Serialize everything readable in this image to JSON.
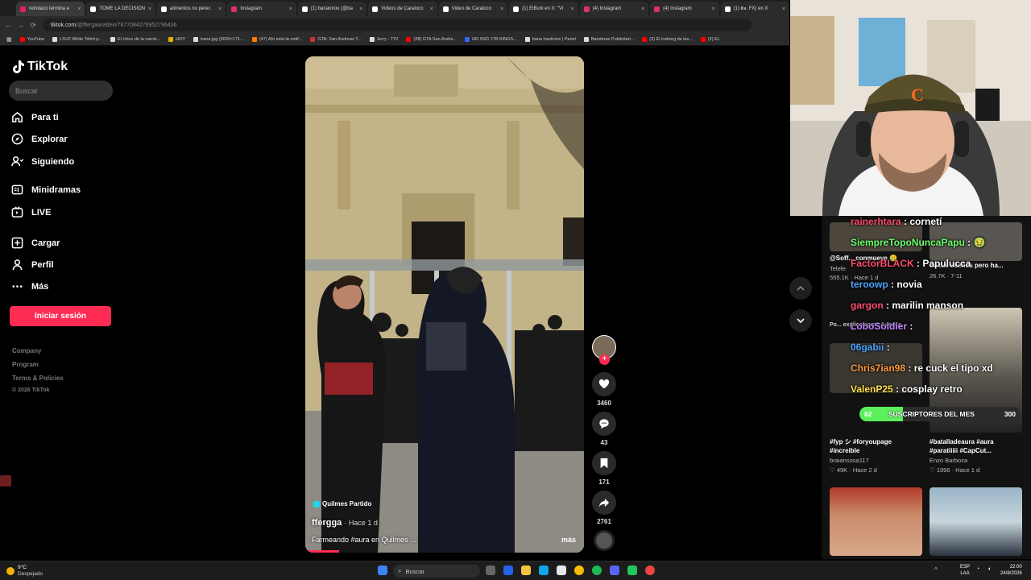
{
  "browser": {
    "tabs": [
      {
        "label": "retrolazo termina e",
        "color": "#e91e63"
      },
      {
        "label": "TOME LA DECISION",
        "color": "#ffffff"
      },
      {
        "label": "alimentos no perec",
        "color": "#ffffff"
      },
      {
        "label": "Instagram",
        "color": "#e1306c"
      },
      {
        "label": "(1) bananirou (@ba",
        "color": "#ffffff"
      },
      {
        "label": "Videos de Caraloco",
        "color": "#ffffff"
      },
      {
        "label": "Video de Caraloco",
        "color": "#ffffff"
      },
      {
        "label": "(1) ElBuni en X: \"Vi",
        "color": "#ffffff"
      },
      {
        "label": "(4) Instagram",
        "color": "#e1306c"
      },
      {
        "label": "(4) Instagram",
        "color": "#e1306c"
      },
      {
        "label": "(1) 𝕰𝖆. FX) en X",
        "color": "#ffffff"
      }
    ],
    "url_host": "tiktok.com",
    "url_path": "/@ffergaa/video/7677084276952796436",
    "bookmarks": [
      {
        "label": "YouTube",
        "color": "#ff0000"
      },
      {
        "label": "LSV2 White Tshirt p...",
        "color": "#dddddd"
      },
      {
        "label": "El chico de la camis...",
        "color": "#dddddd"
      },
      {
        "label": "HOY",
        "color": "#e0b000"
      },
      {
        "label": "bana.jpg (3000×171...",
        "color": "#dddddd"
      },
      {
        "label": "(47) Ahí esta la notif...",
        "color": "#ff7a00"
      },
      {
        "label": "GTA: San Andreas T...",
        "color": "#cc3333"
      },
      {
        "label": "Jerry - 77V",
        "color": "#dddddd"
      },
      {
        "label": "(28) GTA San Andre...",
        "color": "#ff0000"
      },
      {
        "label": "HD SSD 1TB KINGS...",
        "color": "#3366ff"
      },
      {
        "label": "bana hardcore | Panel",
        "color": "#dddddd"
      },
      {
        "label": "Banderas Publicitari...",
        "color": "#dddddd"
      },
      {
        "label": "(2) El iceberg de las...",
        "color": "#ff0000"
      },
      {
        "label": "(2) EL",
        "color": "#ff0000"
      }
    ]
  },
  "tiktok": {
    "logo": "TikTok",
    "search_placeholder": "Buscar",
    "nav": [
      {
        "label": "Para ti",
        "icon": "home-icon"
      },
      {
        "label": "Explorar",
        "icon": "compass-icon"
      },
      {
        "label": "Siguiendo",
        "icon": "following-icon"
      },
      {
        "label": "Minidramas",
        "icon": "minidramas-icon"
      },
      {
        "label": "LIVE",
        "icon": "live-icon"
      },
      {
        "label": "Cargar",
        "icon": "upload-icon"
      },
      {
        "label": "Perfil",
        "icon": "profile-icon"
      },
      {
        "label": "Más",
        "icon": "more-icon"
      }
    ],
    "login": "Iniciar sesión",
    "footer": [
      "Company",
      "Program",
      "Terms & Policies",
      "© 2026 TikTok"
    ],
    "accent": "#fe2c55"
  },
  "video": {
    "location": "Quilmes Partido",
    "author": "ffergga",
    "time": "· Hace 1 d",
    "caption": "Farmeando #aura en Quilmes ...",
    "more": "más",
    "progress_fraction": 0.12,
    "actions": {
      "likes": "3460",
      "comments": "43",
      "saves": "171",
      "shares": "2761"
    }
  },
  "right_cards": [
    {
      "title": "@Soff... conmueve 🥲",
      "meta_left": "Telefe",
      "stats": "555.1K · Hace 1 d"
    },
    {
      "title": "de tus sueños pero ha...",
      "meta_left": "",
      "stats": "26.7K · 7-11"
    },
    {
      "title": "Po... explico como 4 veces",
      "meta_left": "",
      "stats": ""
    },
    {
      "title": "#fyp シ #foryoupage #increible",
      "user": "braiansosa117",
      "stats": "49K · Hace 2 d"
    },
    {
      "title": "#batalladeaura #aura #paratiiiii #CapCut...",
      "user": "Enzo Barboza",
      "stats": "1996 · Hace 1 d"
    }
  ],
  "chat": [
    {
      "user": "rainerhtara",
      "text": " : cornetí",
      "color": "#ff4d6d"
    },
    {
      "user": "SiempreTopoNuncaPapu",
      "text": " : 🤢",
      "color": "#6cff6c"
    },
    {
      "user": "FactorBLACK",
      "text": " : Papulucca",
      "color": "#ff4d6d"
    },
    {
      "user": "teroowp",
      "text": " : novia",
      "color": "#4da6ff"
    },
    {
      "user": "gargon",
      "text": " : marilin manson",
      "color": "#ff4d6d"
    },
    {
      "user": "LoboSoldier",
      "text": " :",
      "color": "#c084ff"
    },
    {
      "user": "06gabii",
      "text": " :",
      "color": "#4da6ff"
    },
    {
      "user": "Chris7ian98",
      "text": " : re cuck el tipo xd",
      "color": "#ff9a3c"
    },
    {
      "user": "ValenP25",
      "text": " : cosplay retro",
      "color": "#ffe04d"
    }
  ],
  "sub_goal": {
    "label": "SUSCRIPTORES DEL MES",
    "current": "82",
    "target": "300",
    "fraction": 0.27,
    "color": "#5cf05c"
  },
  "taskbar": {
    "weather_temp": "9°C",
    "weather_desc": "Despejado",
    "search": "Buscar",
    "lang": "ESP",
    "lang2": "LAA",
    "time": "22:00",
    "date": "24/8/2026"
  }
}
